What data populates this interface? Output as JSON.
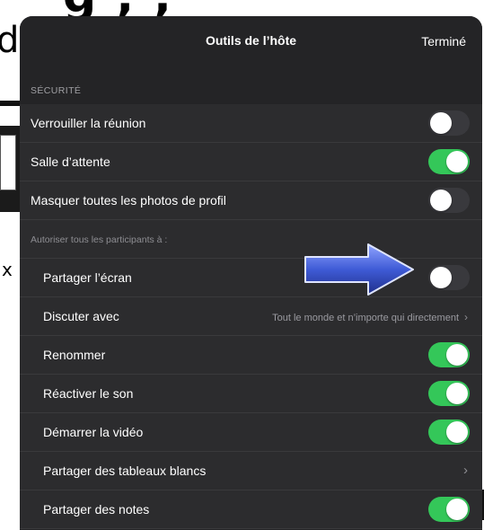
{
  "background": {
    "top_text": "g , ,",
    "left_letter": "d",
    "left_x": "x"
  },
  "header": {
    "title": "Outils de l’hôte",
    "done_label": "Terminé"
  },
  "security": {
    "section_label": "SÉCURITÉ",
    "rows": [
      {
        "label": "Verrouiller la réunion",
        "on": false
      },
      {
        "label": "Salle d’attente",
        "on": true
      },
      {
        "label": "Masquer toutes les photos de profil",
        "on": false
      }
    ]
  },
  "participants": {
    "section_label": "Autoriser tous les participants à :",
    "share_screen": {
      "label": "Partager l’écran",
      "on": false
    },
    "chat": {
      "label": "Discuter avec",
      "value": "Tout le monde et n’importe qui directement"
    },
    "rename": {
      "label": "Renommer",
      "on": true
    },
    "unmute": {
      "label": "Réactiver le son",
      "on": true
    },
    "start_video": {
      "label": "Démarrer la vidéo",
      "on": true
    },
    "whiteboards": {
      "label": "Partager des tableaux blancs"
    },
    "notes": {
      "label": "Partager des notes",
      "on": true
    }
  },
  "colors": {
    "toggle_on": "#34c759",
    "toggle_off": "#39393d",
    "panel": "#242426",
    "row": "#2c2c2e",
    "arrow": "#3f5bd6"
  },
  "annotation": {
    "icon": "blue-arrow-icon"
  }
}
